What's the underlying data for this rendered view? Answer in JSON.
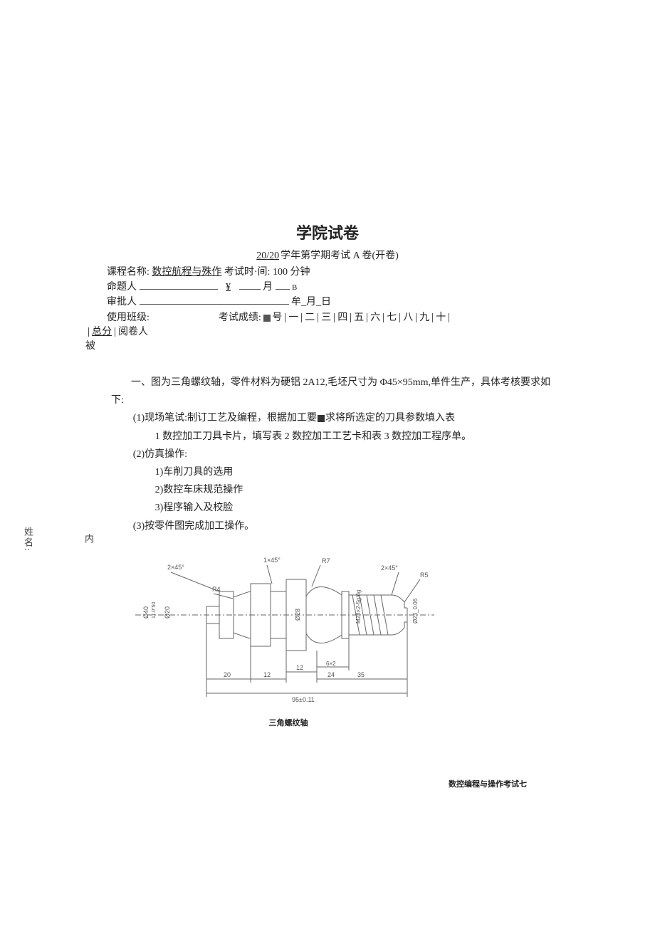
{
  "sidebar": {
    "name_label": "姓名:",
    "nei": "内"
  },
  "header": {
    "title": "学院试卷",
    "subtitle_prefix": "20",
    "subtitle_mid": "/20",
    "subtitle_rest": "学年第学期考试 A 卷(开卷)"
  },
  "meta": {
    "course_label": "课程名称:",
    "course_value": "数控航程与殊作",
    "exam_time_label": "考试时·间:",
    "exam_time_value": "100 分钟",
    "author_label": "命题人",
    "author_y": "¥",
    "author_m": "月",
    "author_b": "B",
    "approver_label": "审批人",
    "approver_ym": "牟_月_日",
    "class_label": "使用班级:",
    "score_label": "考试成绩:"
  },
  "score_cells": [
    "号",
    "一",
    "二",
    "三",
    "四",
    "五",
    "六",
    "七",
    "八",
    "九",
    "十"
  ],
  "totals": {
    "total": "总分",
    "reader": "阅卷人",
    "below": "被"
  },
  "section1": {
    "lead": "一、图为三角螺纹轴，零件材料为硬铝 2A12,毛坯尺寸为 Φ45×95mm,单件生产，具体考核要求如下:",
    "p1a": "(1)现场笔试:制订工艺及编程，根据加工要",
    "p1b": "求将所选定的刀具参数填入表",
    "p1tables": "1 数控加工刀具卡片，填写表 2 数控加工工艺卡和表 3 数控加工程序单。",
    "p2": "(2)仿真操作:",
    "p2_1": "1)车削刀具的选用",
    "p2_2": "2)数控车床规范操作",
    "p2_3": "3)程序输入及校脸",
    "p3": "(3)按零件图完成加工操作。"
  },
  "figure": {
    "caption": "三角螺纹轴",
    "labels": {
      "chamfer_left": "2×45°",
      "chamfer_mid": "1×45°",
      "r7": "R7",
      "chamfer_right": "2×45°",
      "r5": "R5",
      "r4": "R4",
      "d20": "Ø20",
      "d28": "Ø28",
      "thread": "M28×2-5g/6g",
      "notch": "6×2",
      "right_dia": "Ø23_0.06",
      "dim20": "20",
      "dim12a": "12",
      "dim12b": "12",
      "dim24": "24",
      "dim35": "35",
      "dimTotal": "95±0.11",
      "left_d1": "Ø40",
      "left_d2": "11.0″50"
    }
  },
  "footer": "数控编程与操作考试七"
}
